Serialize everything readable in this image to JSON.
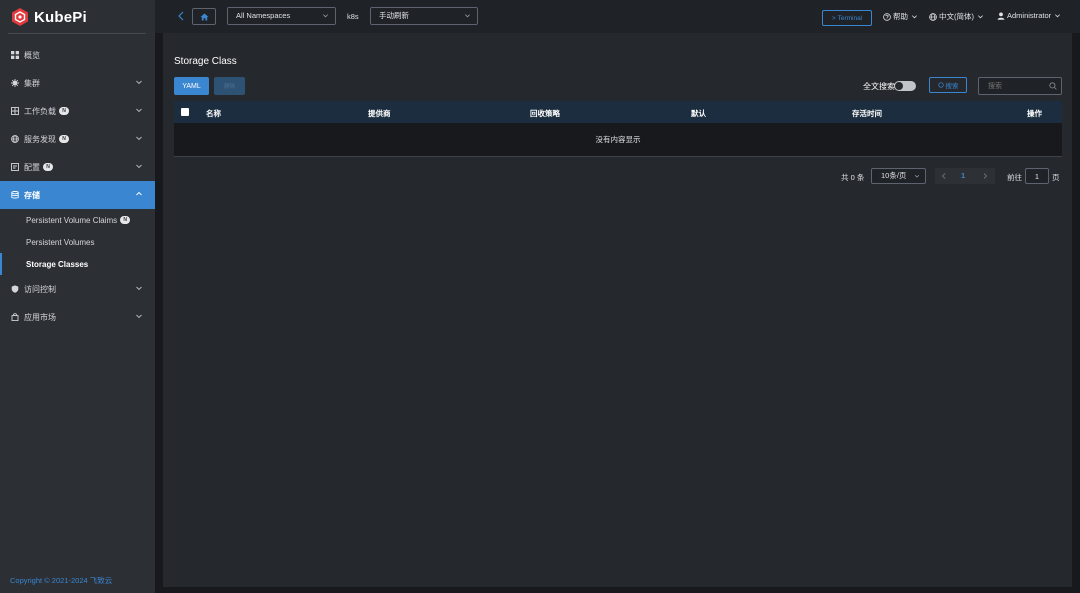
{
  "app": {
    "name": "KubePi"
  },
  "sidebar": {
    "items": [
      {
        "label": "概览",
        "icon": "dashboard-icon"
      },
      {
        "label": "集群",
        "icon": "cluster-icon"
      },
      {
        "label": "工作负载",
        "icon": "workload-icon",
        "badge": "N"
      },
      {
        "label": "服务发现",
        "icon": "globe-icon",
        "badge": "N"
      },
      {
        "label": "配置",
        "icon": "config-icon",
        "badge": "N"
      },
      {
        "label": "存储",
        "icon": "database-icon"
      },
      {
        "label": "访问控制",
        "icon": "shield-icon"
      },
      {
        "label": "应用市场",
        "icon": "shopping-bag-icon"
      }
    ],
    "storage_sub": [
      {
        "label": "Persistent Volume Claims",
        "badge": "N"
      },
      {
        "label": "Persistent Volumes"
      },
      {
        "label": "Storage Classes"
      }
    ],
    "copyright": "Copyright © 2021-2024 飞致云"
  },
  "topbar": {
    "namespace": "All Namespaces",
    "cluster": "k8s",
    "refresh": "手动刷新",
    "terminal": "Terminal",
    "help": "帮助",
    "language": "中文(简体)",
    "user": "Administrator"
  },
  "main": {
    "title": "Storage Class",
    "yaml_label": "YAML",
    "delete_label": "删除",
    "fulltext_label": "全文搜索",
    "search_btn": "搜索",
    "search_placeholder": "搜索",
    "columns": [
      "名称",
      "提供商",
      "回收策略",
      "默认",
      "存活时间",
      "操作"
    ],
    "empty_text": "没有内容显示"
  },
  "pagination": {
    "total": "共 0 条",
    "page_size": "10条/页",
    "current_page": "1",
    "goto_label": "前往",
    "goto_value": "1",
    "page_suffix": "页"
  },
  "colors": {
    "accent": "#3a86d0",
    "sidebar": "#2c2f34",
    "background": "#17191c",
    "panel": "#25282c"
  }
}
